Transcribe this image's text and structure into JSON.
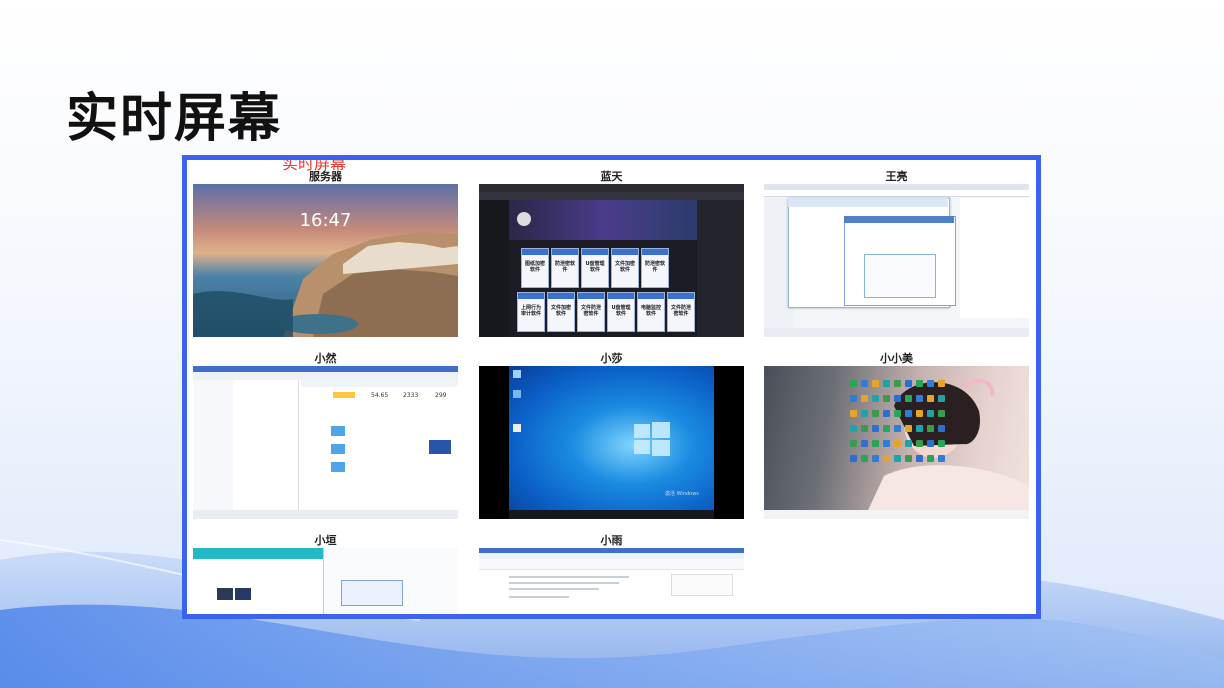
{
  "page": {
    "title": "实时屏幕",
    "frame_header": "实时屏幕"
  },
  "screens": [
    {
      "name": "服务器",
      "clock": "16:47"
    },
    {
      "name": "蓝天",
      "tiles": [
        "图纸加密软件",
        "防泄密软件",
        "U盘管理软件",
        "文件加密软件",
        "防泄密软件",
        "上网行为审计软件",
        "文件加密软件",
        "文件防泄密软件",
        "U盘管理软件",
        "电脑监控软件",
        "文件防泄密软件"
      ]
    },
    {
      "name": "王亮"
    },
    {
      "name": "小然",
      "stats": [
        "54.65",
        "2333",
        "299"
      ]
    },
    {
      "name": "小莎",
      "watermark": "激活 Windows"
    },
    {
      "name": "小小美"
    },
    {
      "name": "小垣"
    },
    {
      "name": "小雨"
    }
  ],
  "colors": {
    "accent": "#3b63f0",
    "frame_header": "#e53935"
  }
}
